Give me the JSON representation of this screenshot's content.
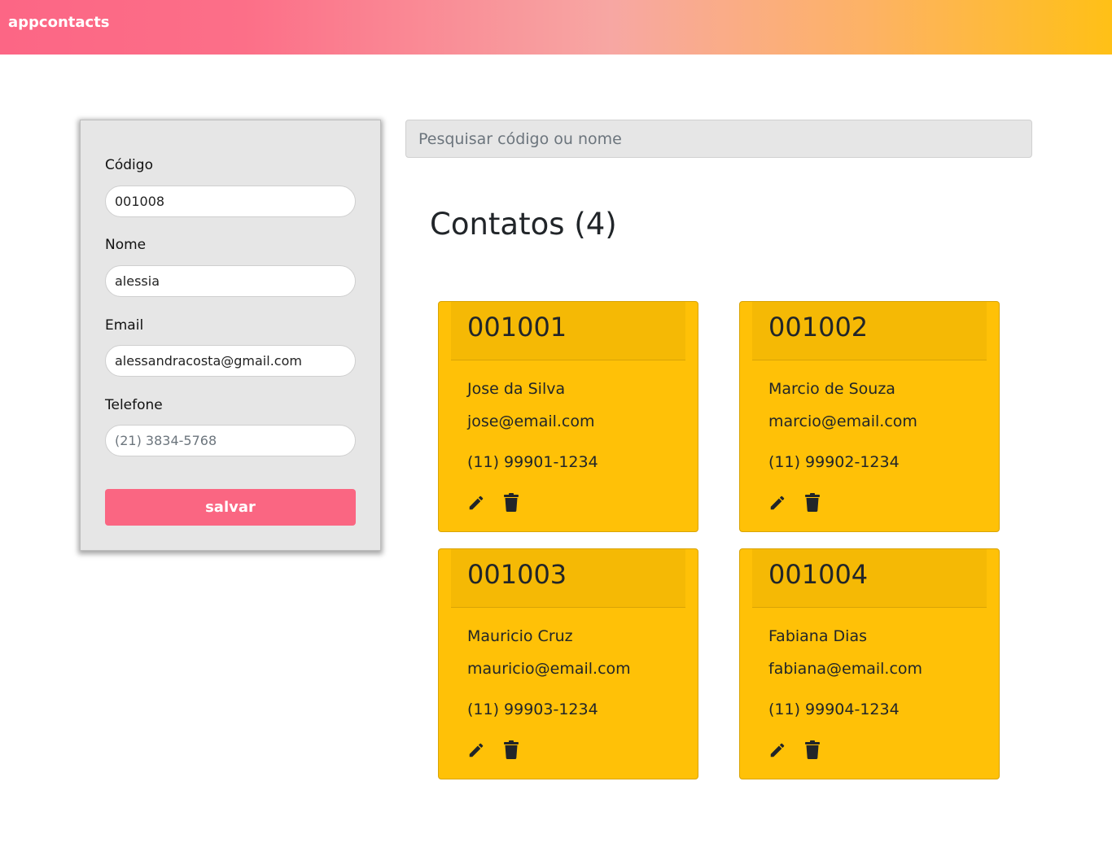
{
  "brand": "appcontacts",
  "form": {
    "codigo_label": "Código",
    "codigo_value": "001008",
    "nome_label": "Nome",
    "nome_value": "alessia",
    "email_label": "Email",
    "email_value": "alessandracosta@gmail.com",
    "telefone_label": "Telefone",
    "telefone_placeholder": "(21) 3834-5768",
    "save_label": "salvar"
  },
  "search": {
    "placeholder": "Pesquisar código ou nome"
  },
  "list": {
    "title": "Contatos (4)"
  },
  "contacts": [
    {
      "code": "001001",
      "name": "Jose da Silva",
      "email": "jose@email.com",
      "phone": "(11) 99901-1234"
    },
    {
      "code": "001002",
      "name": "Marcio de Souza",
      "email": "marcio@email.com",
      "phone": "(11) 99902-1234"
    },
    {
      "code": "001003",
      "name": "Mauricio Cruz",
      "email": "mauricio@email.com",
      "phone": "(11) 99903-1234"
    },
    {
      "code": "001004",
      "name": "Fabiana Dias",
      "email": "fabiana@email.com",
      "phone": "(11) 99904-1234"
    }
  ],
  "icons": {
    "edit": "pencil-icon",
    "delete": "trash-icon"
  },
  "colors": {
    "card": "#ffc107",
    "accent": "#fa6682",
    "panel": "#e6e6e6"
  }
}
